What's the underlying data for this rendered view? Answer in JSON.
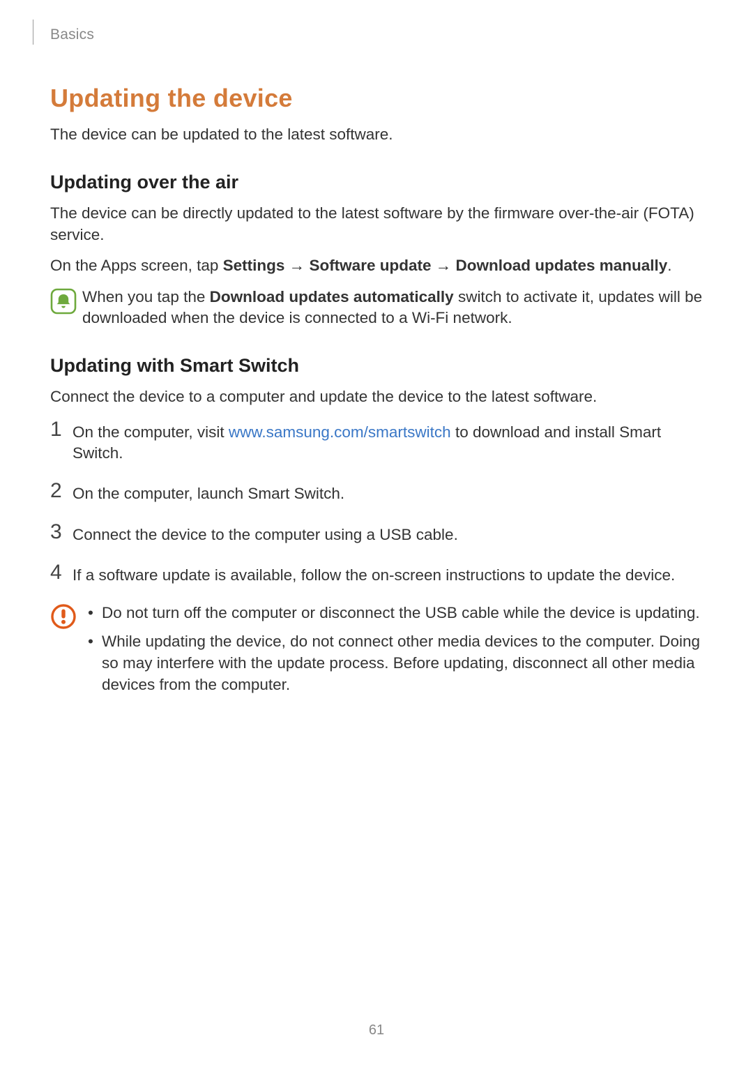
{
  "breadcrumb": "Basics",
  "title": "Updating the device",
  "intro": "The device can be updated to the latest software.",
  "section_ota": {
    "heading": "Updating over the air",
    "p1": "The device can be directly updated to the latest software by the firmware over-the-air (FOTA) service.",
    "p2_pre": "On the Apps screen, tap ",
    "p2_b1": "Settings",
    "p2_arrow1": " → ",
    "p2_b2": "Software update",
    "p2_arrow2": " → ",
    "p2_b3": "Download updates manually",
    "p2_post": ".",
    "note_pre": "When you tap the ",
    "note_bold": "Download updates automatically",
    "note_post": " switch to activate it, updates will be downloaded when the device is connected to a Wi-Fi network."
  },
  "section_smart": {
    "heading": "Updating with Smart Switch",
    "p1": "Connect the device to a computer and update the device to the latest software.",
    "steps": [
      {
        "num": "1",
        "pre": "On the computer, visit ",
        "link": "www.samsung.com/smartswitch",
        "post": " to download and install Smart Switch."
      },
      {
        "num": "2",
        "text": "On the computer, launch Smart Switch."
      },
      {
        "num": "3",
        "text": "Connect the device to the computer using a USB cable."
      },
      {
        "num": "4",
        "text": "If a software update is available, follow the on-screen instructions to update the device."
      }
    ],
    "caution": [
      "Do not turn off the computer or disconnect the USB cable while the device is updating.",
      "While updating the device, do not connect other media devices to the computer. Doing so may interfere with the update process. Before updating, disconnect all other media devices from the computer."
    ]
  },
  "page_number": "61",
  "bullet_char": "•"
}
